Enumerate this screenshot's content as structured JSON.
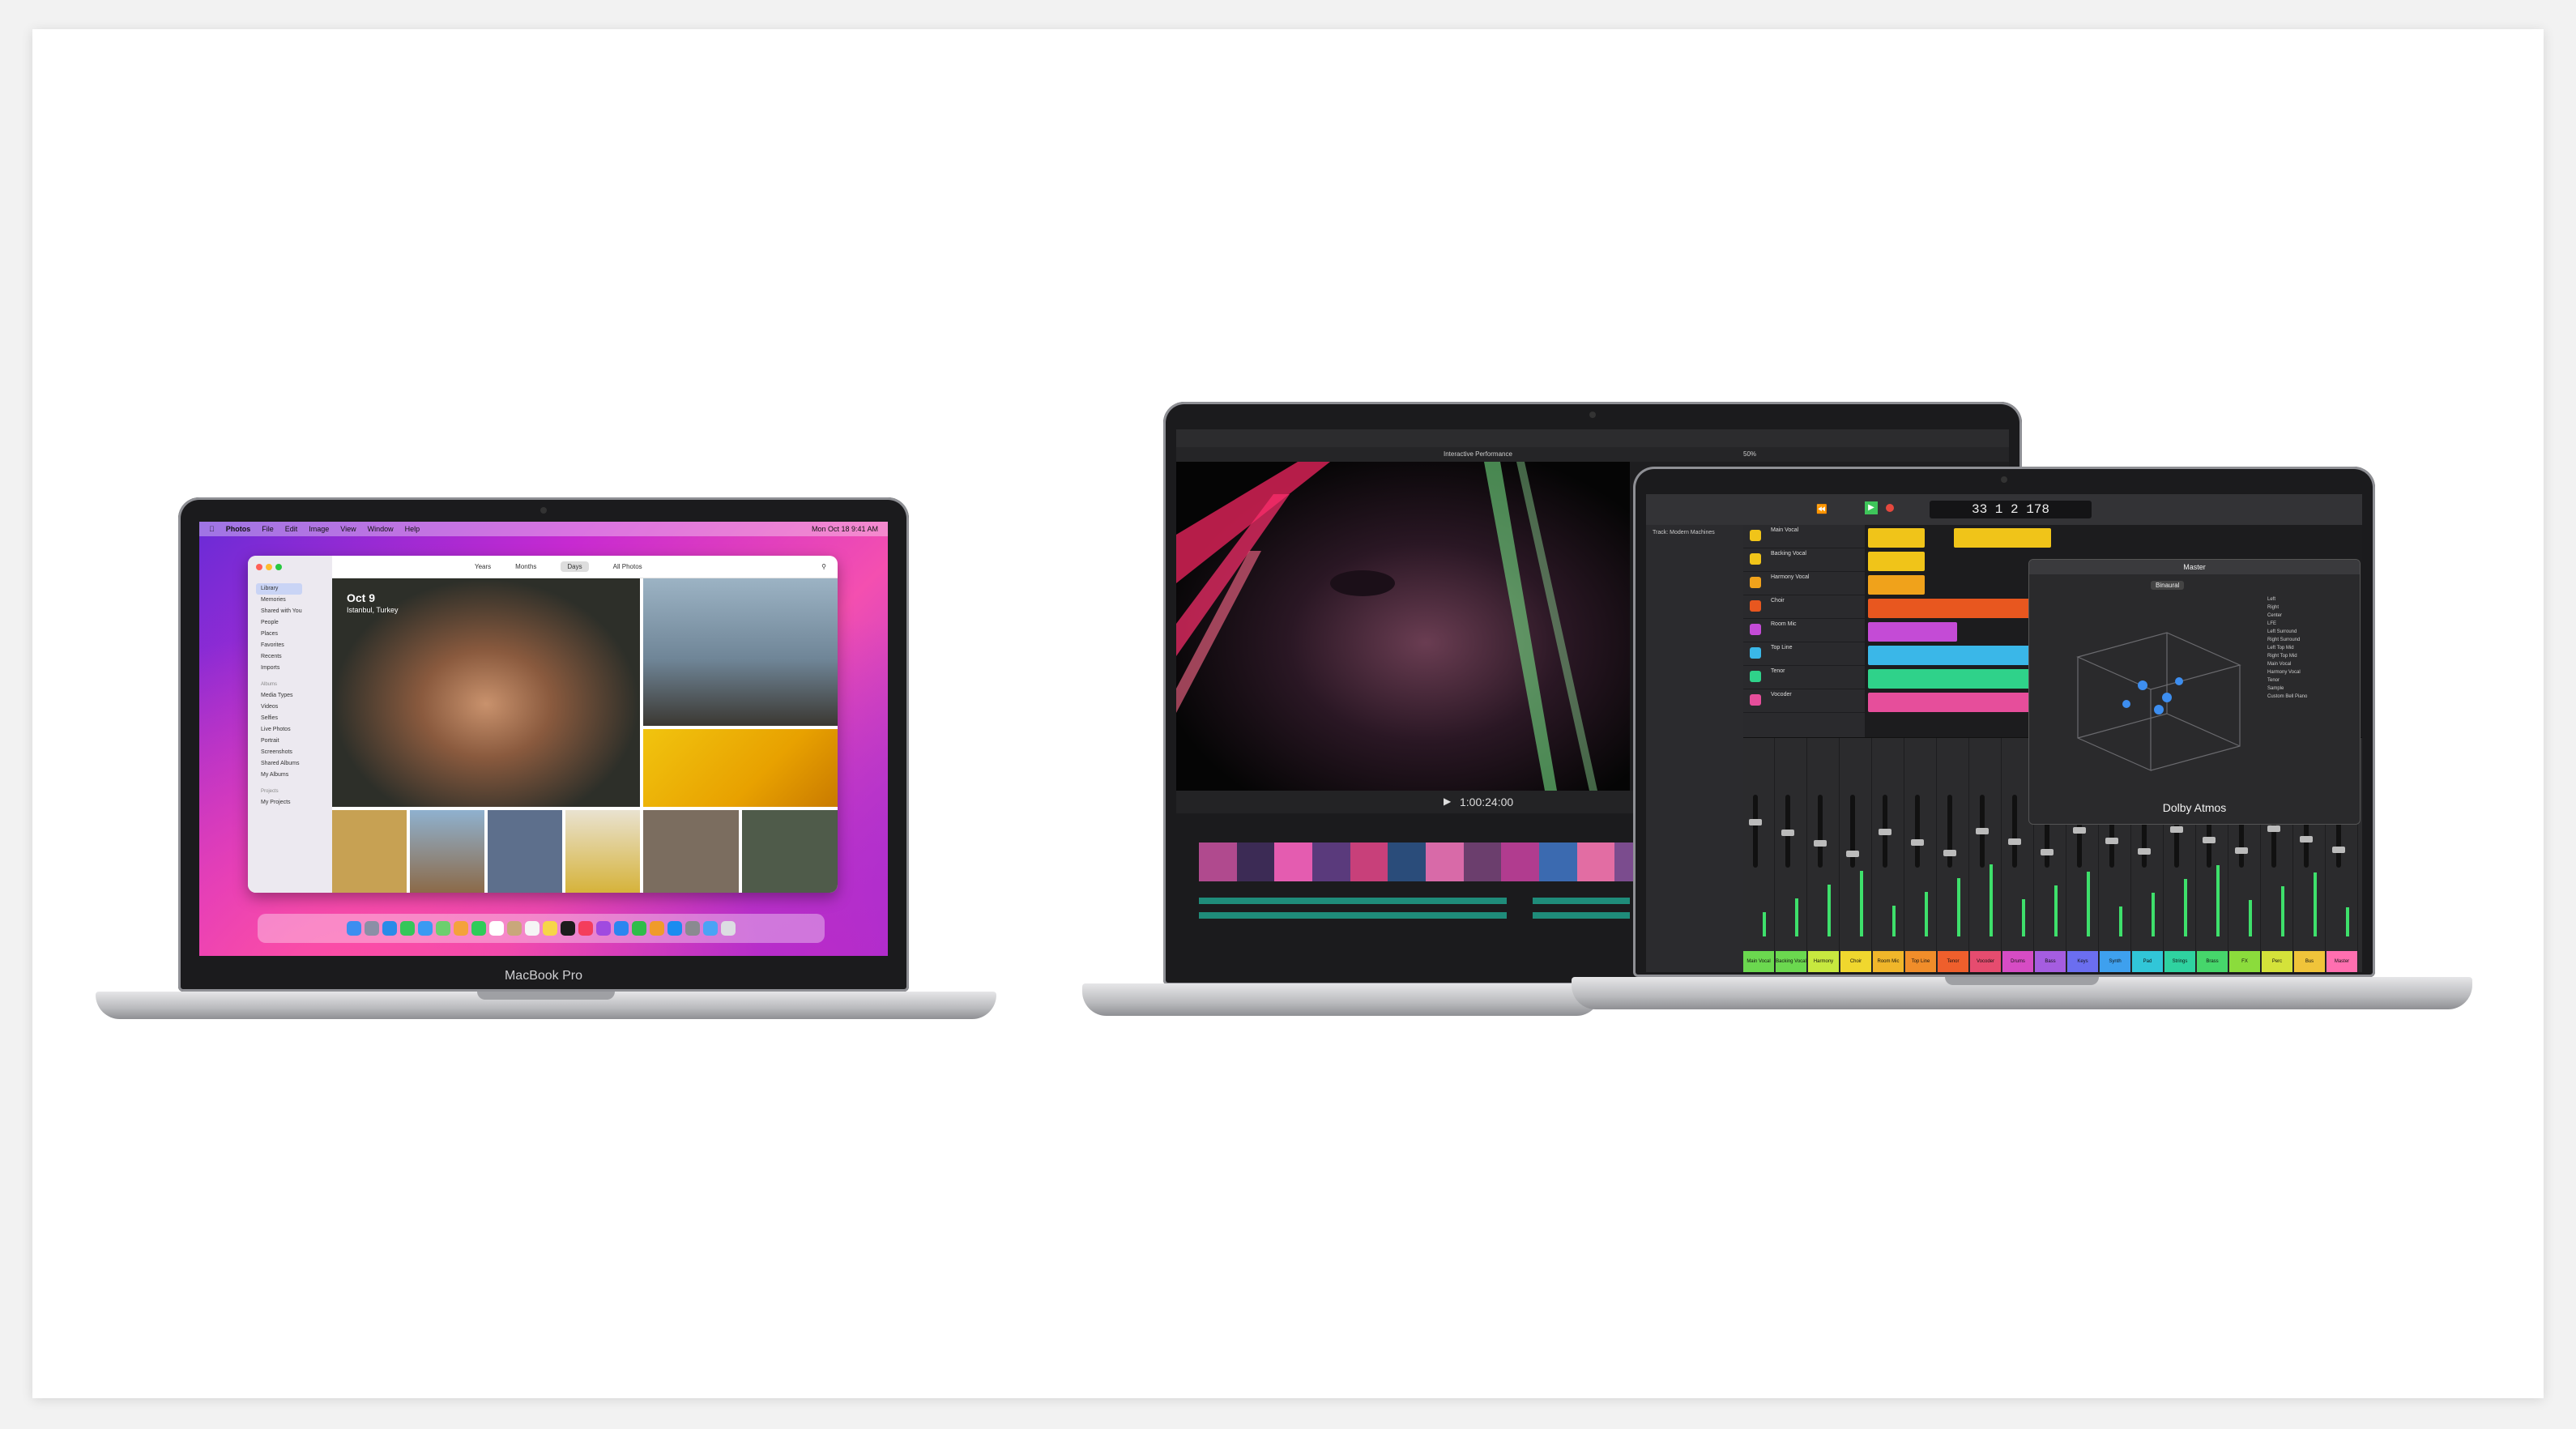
{
  "small_laptop": {
    "base_label": "MacBook Pro",
    "menubar": {
      "app": "Photos",
      "items": [
        "File",
        "Edit",
        "Image",
        "View",
        "Window",
        "Help"
      ],
      "clock": "Mon Oct 18  9:41 AM"
    },
    "photos": {
      "tabs": [
        "Years",
        "Months",
        "Days",
        "All Photos"
      ],
      "active_tab": "Days",
      "sidebar": [
        "Library",
        "Memories",
        "Shared with You",
        "People",
        "Places",
        "Favorites",
        "Recents",
        "Imports"
      ],
      "sidebar_section": "Albums",
      "sidebar_more": [
        "Media Types",
        "Videos",
        "Selfies",
        "Live Photos",
        "Portrait",
        "Screenshots",
        "Shared Albums",
        "My Albums"
      ],
      "sidebar_projects": "Projects",
      "sidebar_projects_item": "My Projects",
      "date": "Oct 9",
      "location": "Istanbul, Turkey"
    }
  },
  "large_laptop": {
    "app_bar_title": "Interactive Performance",
    "timecode": "1:00:24:00",
    "zoom": "50%"
  },
  "front_laptop": {
    "lcd": "33  1  2 178",
    "track_header": "Track: Modern Machines",
    "tracks": [
      "Main Vocal",
      "Backing Vocal",
      "Harmony Vocal",
      "Choir",
      "Room Mic",
      "Top Line",
      "Tenor",
      "Vocoder"
    ],
    "panel_title": "Master",
    "panel_mode": "Binaural",
    "panel_label": "Dolby Atmos",
    "channel_list": [
      "Left",
      "Right",
      "Center",
      "LFE",
      "Left Surround",
      "Right Surround",
      "Left Top Mid",
      "Right Top Mid",
      "Main Vocal",
      "Harmony Vocal",
      "Tenor",
      "Sample",
      "Custom Bell Piano"
    ],
    "mixer_tags": [
      "Main Vocal",
      "Backing Vocal",
      "Harmony Vocal",
      "Choir",
      "Room Mic",
      "Top Line",
      "Tenor",
      "Vocoder",
      "Drums",
      "Bass",
      "Keys",
      "Synth",
      "Pad",
      "Strings",
      "Brass",
      "FX",
      "Perc",
      "Bus",
      "Master"
    ]
  },
  "colors": {
    "tracks": [
      "#f0c419",
      "#f0c419",
      "#f0a21b",
      "#e8571f",
      "#c44bd6",
      "#3ab7e8",
      "#2fd28a",
      "#e64e9b"
    ],
    "mixer": [
      "#6bd84f",
      "#6bd84f",
      "#c7e83f",
      "#f0d72e",
      "#f0b62a",
      "#f08d2a",
      "#ef5f2c",
      "#e64c6f",
      "#d64cc4",
      "#a55de0",
      "#6b6ef0",
      "#3ea0ee",
      "#31c6d8",
      "#2fd2a0",
      "#46d66b",
      "#8bdc3c",
      "#d4e23a",
      "#f0c43a",
      "#ff6fb0"
    ]
  }
}
